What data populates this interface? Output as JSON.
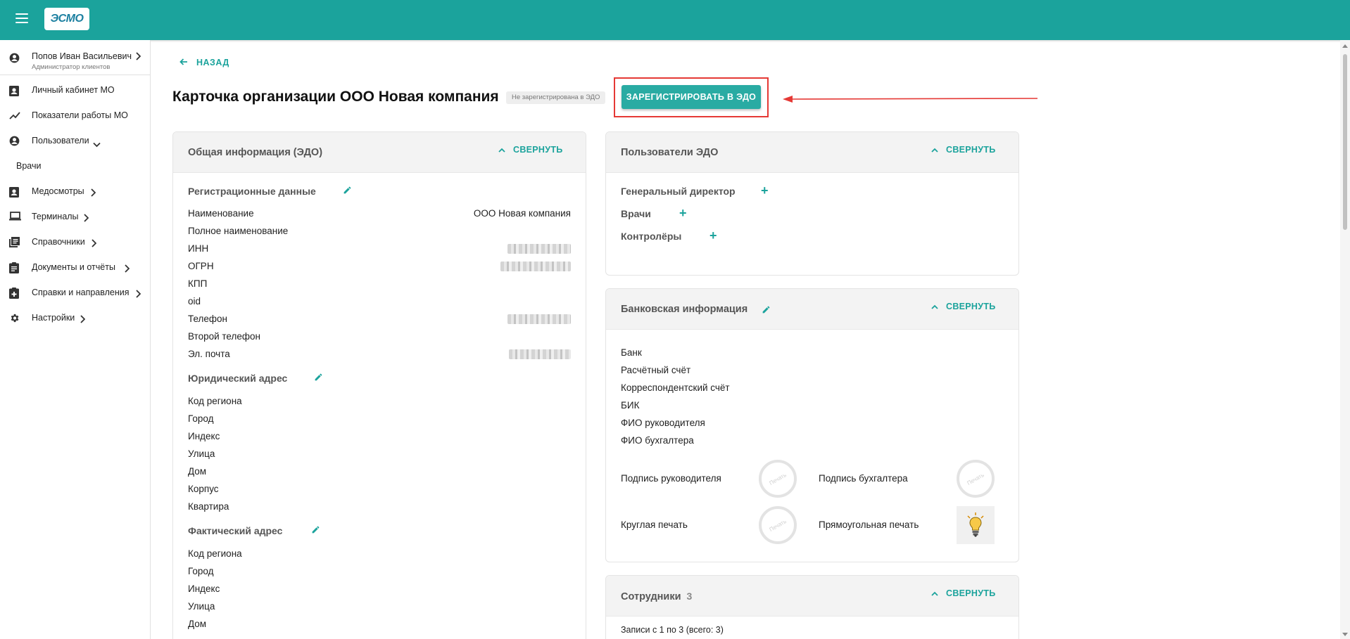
{
  "header": {
    "logo_text": "ЭСМО"
  },
  "sidebar": {
    "user": {
      "name": "Попов Иван Васильевич",
      "role": "Администратор клиентов"
    },
    "items": [
      {
        "label": "Личный кабинет МО",
        "icon": "badge-icon"
      },
      {
        "label": "Показатели работы МО",
        "icon": "trend-icon"
      },
      {
        "label": "Пользователи",
        "icon": "account-icon"
      },
      {
        "label": "Врачи"
      },
      {
        "label": "Медосмотры",
        "icon": "badge-icon"
      },
      {
        "label": "Терминалы",
        "icon": "laptop-icon"
      },
      {
        "label": "Справочники",
        "icon": "library-icon"
      },
      {
        "label": "Документы и отчёты",
        "icon": "clipboard-icon"
      },
      {
        "label": "Справки и направления",
        "icon": "medical-clipboard-icon"
      },
      {
        "label": "Настройки",
        "icon": "gear-icon"
      }
    ]
  },
  "main": {
    "back_label": "НАЗАД",
    "title": "Карточка организации ООО Новая компания",
    "status_badge": "Не зарегистрирована в ЭДО",
    "register_button": "ЗАРЕГИСТРИРОВАТЬ В ЭДО"
  },
  "general_card": {
    "title": "Общая информация (ЭДО)",
    "collapse_label": "СВЕРНУТЬ",
    "registration": {
      "title": "Регистрационные данные",
      "rows": [
        {
          "label": "Наименование",
          "value": "ООО Новая компания"
        },
        {
          "label": "Полное наименование",
          "value": ""
        },
        {
          "label": "ИНН",
          "value": ""
        },
        {
          "label": "ОГРН",
          "value": ""
        },
        {
          "label": "КПП",
          "value": ""
        },
        {
          "label": "oid",
          "value": ""
        },
        {
          "label": "Телефон",
          "value": ""
        },
        {
          "label": "Второй телефон",
          "value": ""
        },
        {
          "label": "Эл. почта",
          "value": ""
        }
      ]
    },
    "legal_address": {
      "title": "Юридический адрес",
      "rows": [
        "Код региона",
        "Город",
        "Индекс",
        "Улица",
        "Дом",
        "Корпус",
        "Квартира"
      ]
    },
    "actual_address": {
      "title": "Фактический адрес",
      "rows": [
        "Код региона",
        "Город",
        "Индекс",
        "Улица",
        "Дом"
      ]
    }
  },
  "edo_users_card": {
    "title": "Пользователи ЭДО",
    "collapse_label": "СВЕРНУТЬ",
    "roles": [
      "Генеральный директор",
      "Врачи",
      "Контролёры"
    ]
  },
  "bank_card": {
    "title": "Банковская информация",
    "collapse_label": "СВЕРНУТЬ",
    "rows": [
      "Банк",
      "Расчётный счёт",
      "Корреспондентский счёт",
      "БИК",
      "ФИО руководителя",
      "ФИО бухгалтера"
    ],
    "signatures": {
      "head_signature": "Подпись руководителя",
      "accountant_signature": "Подпись бухгалтера",
      "round_stamp": "Круглая печать",
      "rect_stamp": "Прямоугольная печать",
      "stamp_placeholder": "Печать"
    }
  },
  "employees_card": {
    "title": "Сотрудники",
    "count": "3",
    "collapse_label": "СВЕРНУТЬ",
    "records_info": "Записи с 1 по 3 (всего: 3)"
  },
  "colors": {
    "accent": "#1ba39c",
    "highlight": "#e53935"
  }
}
